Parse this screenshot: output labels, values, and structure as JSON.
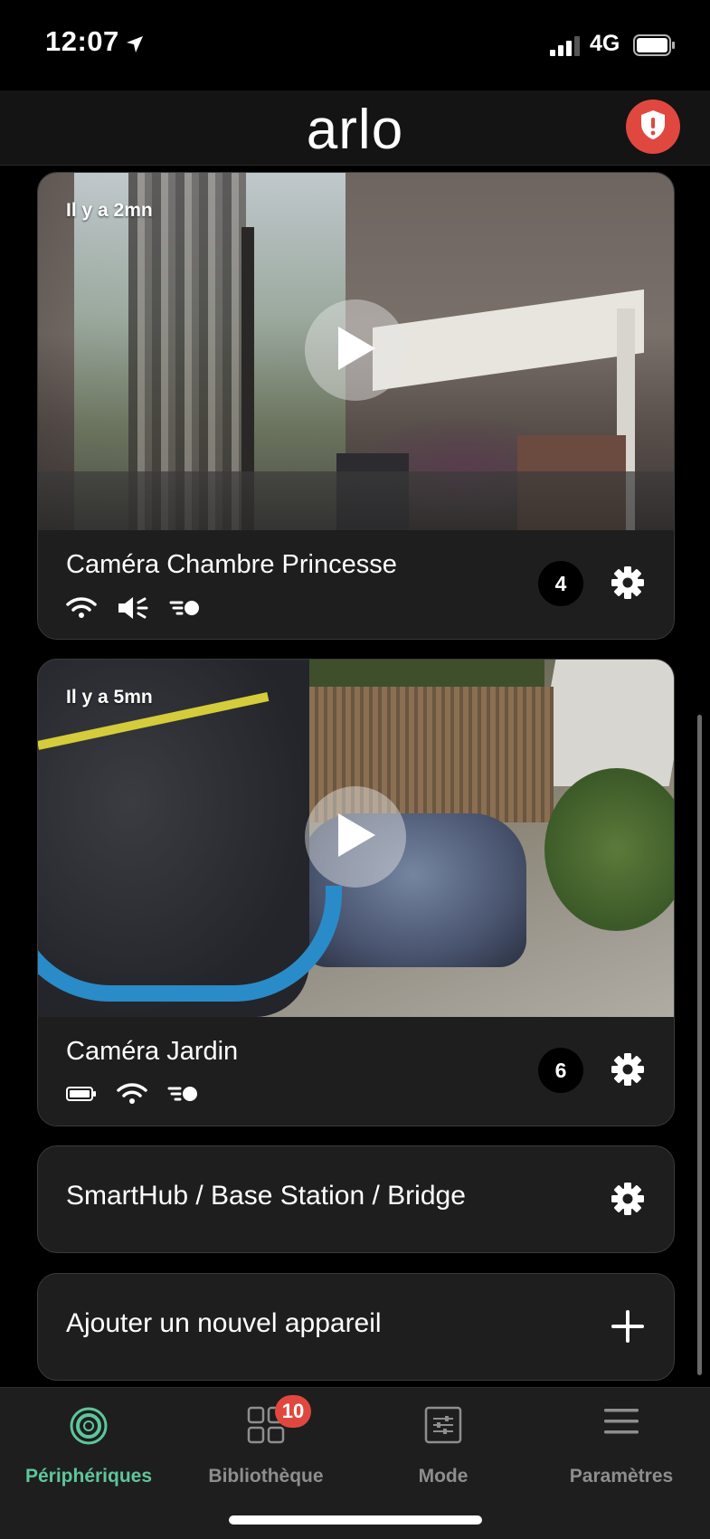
{
  "status_bar": {
    "time": "12:07",
    "network": "4G"
  },
  "header": {
    "logo": "arlo"
  },
  "cameras": [
    {
      "name": "Caméra Chambre Princesse",
      "timestamp": "Il y a 2mn",
      "clip_count": "4",
      "status_icons": [
        "wifi-icon",
        "speaker-icon",
        "motion-icon"
      ]
    },
    {
      "name": "Caméra Jardin",
      "timestamp": "Il y a 5mn",
      "clip_count": "6",
      "status_icons": [
        "battery-icon",
        "wifi-icon",
        "motion-icon"
      ]
    }
  ],
  "hub": {
    "label": "SmartHub / Base Station / Bridge"
  },
  "add_device": {
    "label": "Ajouter un nouvel appareil"
  },
  "tabs": [
    {
      "label": "Périphériques",
      "icon": "devices-icon",
      "active": true
    },
    {
      "label": "Bibliothèque",
      "icon": "library-icon",
      "badge": "10"
    },
    {
      "label": "Mode",
      "icon": "mode-icon"
    },
    {
      "label": "Paramètres",
      "icon": "menu-icon"
    }
  ],
  "colors": {
    "accent": "#5ec69a",
    "alert": "#e0483f",
    "background": "#000000",
    "card": "#1e1e1e"
  }
}
